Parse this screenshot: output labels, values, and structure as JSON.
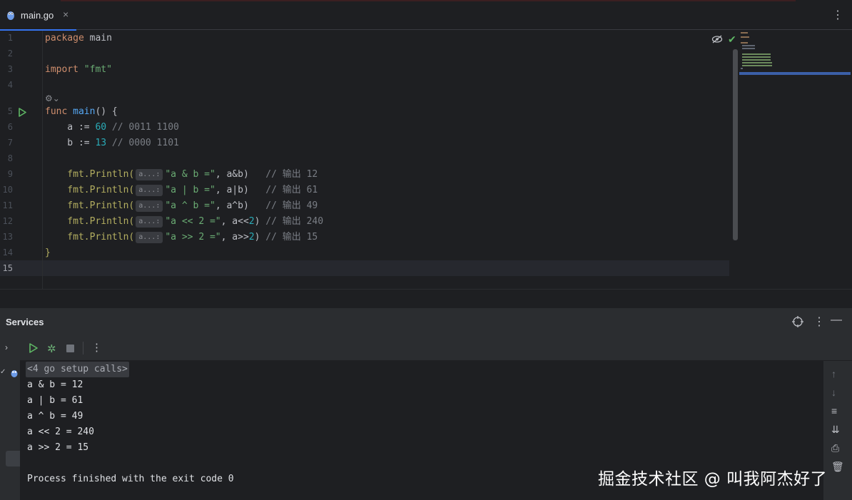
{
  "tab": {
    "title": "main.go",
    "close": "×",
    "more": "⋮"
  },
  "editor": {
    "line_numbers": [
      "1",
      "2",
      "3",
      "4",
      "5",
      "6",
      "7",
      "8",
      "9",
      "10",
      "11",
      "12",
      "13",
      "14",
      "15"
    ],
    "lines": {
      "l1": {
        "kw": "package",
        "rest": " main"
      },
      "l3": {
        "kw": "import",
        "str": "\"fmt\""
      },
      "l5": {
        "kw": "func",
        "fn": "main",
        "rest": "() {"
      },
      "l6": {
        "pre": "    a := ",
        "num": "60",
        "cm": " // 0011 1100"
      },
      "l7": {
        "pre": "    b := ",
        "num": "13",
        "cm": " // 0000 1101"
      },
      "l9": {
        "pkg": "    fmt",
        "call": ".Println(",
        "hint": "a...:",
        "str": "\"a & b =\"",
        "args": ", a&b)",
        "pad": "   ",
        "cm": "// 输出 12"
      },
      "l10": {
        "pkg": "    fmt",
        "call": ".Println(",
        "hint": "a...:",
        "str": "\"a | b =\"",
        "args": ", a|b)",
        "pad": "   ",
        "cm": "// 输出 61"
      },
      "l11": {
        "pkg": "    fmt",
        "call": ".Println(",
        "hint": "a...:",
        "str": "\"a ^ b =\"",
        "args": ", a^b)",
        "pad": "   ",
        "cm": "// 输出 49"
      },
      "l12": {
        "pkg": "    fmt",
        "call": ".Println(",
        "hint": "a...:",
        "str": "\"a << 2 =\"",
        "args1": ", a<<",
        "num": "2",
        "args2": ")",
        "pad": " ",
        "cm": "// 输出 240"
      },
      "l13": {
        "pkg": "    fmt",
        "call": ".Println(",
        "hint": "a...:",
        "str": "\"a >> 2 =\"",
        "args1": ", a>>",
        "num": "2",
        "args2": ")",
        "pad": " ",
        "cm": "// 输出 15"
      },
      "l14": {
        "rest": "}"
      }
    },
    "current_line": 15
  },
  "services": {
    "title": "Services",
    "console_lines": [
      "<4 go setup calls>",
      "a & b = 12",
      "a | b = 61",
      "a ^ b = 49",
      "a << 2 = 240",
      "a >> 2 = 15",
      "",
      "Process finished with the exit code 0"
    ]
  },
  "watermark": "掘金技术社区 @ 叫我阿杰好了",
  "colors": {
    "accent": "#3574f0",
    "run": "#5fb865",
    "keyword": "#cf8e6d",
    "string": "#6aab73",
    "number": "#2aacb8",
    "function": "#56a8f5"
  }
}
